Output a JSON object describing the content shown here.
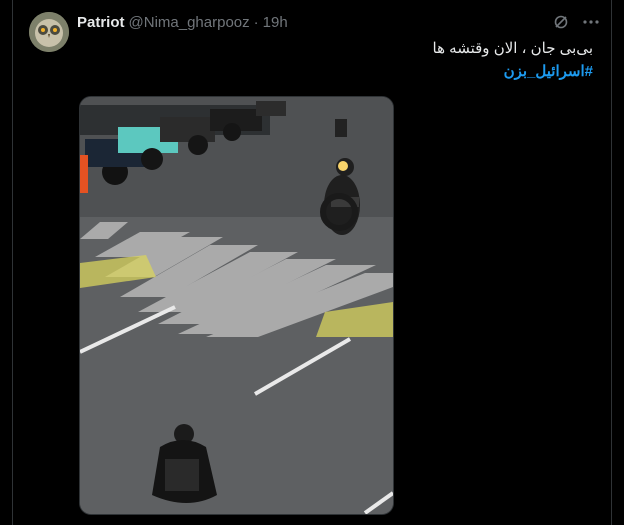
{
  "tweet": {
    "display_name": "Patriot",
    "handle": "@Nima_gharpooz",
    "separator": "·",
    "time": "19h",
    "text": "بی‌بی جان ، الان وقتشه ها",
    "hashtag": "#اسرائیل_بزن"
  },
  "icons": [
    "grok-icon",
    "more-icon"
  ],
  "colors": {
    "background": "#000000",
    "text": "#e7e9ea",
    "secondary": "#71767b",
    "link": "#1d9bf0"
  }
}
